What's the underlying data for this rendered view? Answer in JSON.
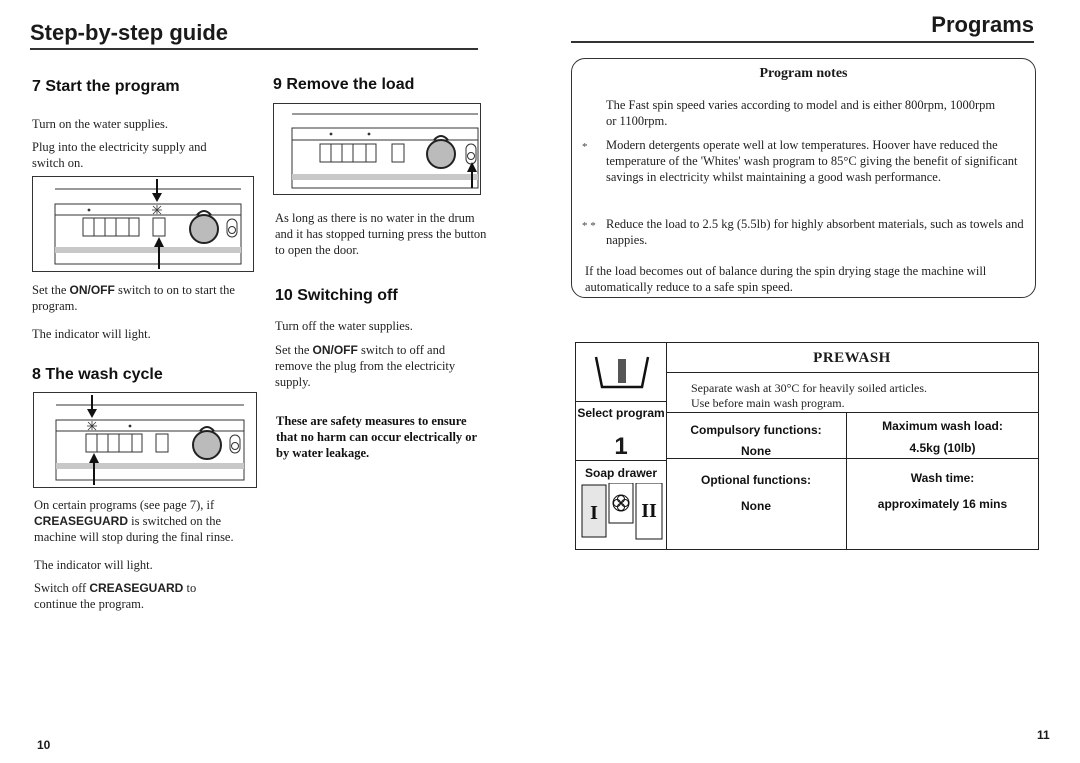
{
  "left_page": {
    "title": "Step-by-step  guide",
    "page_number": "10",
    "sections": {
      "start_program": {
        "heading": "7  Start the program",
        "para1": "Turn on the water supplies.",
        "para2": "Plug into the electricity supply and switch on.",
        "para3_prefix": "Set the ",
        "para3_bold": "ON/OFF",
        "para3_suffix": " switch to on to start the program.",
        "para4": "The indicator will light."
      },
      "wash_cycle": {
        "heading": "8  The wash cycle",
        "para1_prefix": "On certain programs (see page 7), if ",
        "para1_bold": "CREASEGUARD",
        "para1_suffix": " is switched on the machine will stop during the final rinse.",
        "para2": "The indicator will light.",
        "para3_prefix": "Switch off ",
        "para3_bold": "CREASEGUARD",
        "para3_suffix": " to continue the program."
      },
      "remove_load": {
        "heading": "9  Remove the load",
        "para1": "As long as there is no water in the drum and it has stopped turning press the button to open the door."
      },
      "switching_off": {
        "heading": "10  Switching off",
        "para1": "Turn off the water supplies.",
        "para2_prefix": "Set the ",
        "para2_bold": "ON/OFF",
        "para2_suffix": " switch to off and remove the plug from the electricity supply.",
        "para3": "These are safety measures to ensure that no harm can occur electrically or by water leakage."
      }
    }
  },
  "right_page": {
    "title": "Programs",
    "page_number": "11",
    "program_notes": {
      "title": "Program notes",
      "note1": "The Fast spin speed varies according to model and is either 800rpm, 1000rpm or 1100rpm.",
      "note2_marker": "*",
      "note2": "Modern detergents operate well at low temperatures. Hoover have reduced the temperature of the 'Whites' wash program to 85°C giving the benefit of significant savings in electricity whilst maintaining a good wash performance.",
      "note3_marker": "* *",
      "note3": "Reduce the load to 2.5 kg (5.5lb) for highly absorbent materials, such as towels and nappies.",
      "note4": "If the load becomes out of balance during the spin drying stage the machine will automatically reduce to a safe spin speed."
    },
    "program_table": {
      "title": "PREWASH",
      "description_line1": "Separate wash at 30°C for heavily soiled articles.",
      "description_line2": "Use before main wash program.",
      "select_program_label": "Select program",
      "select_program_value": "1",
      "soap_drawer_label": "Soap drawer",
      "soap_drawer_compartments": [
        "I",
        "flower-symbol",
        "II"
      ],
      "compulsory_label": "Compulsory functions:",
      "compulsory_value": "None",
      "max_load_label": "Maximum wash load:",
      "max_load_value": "4.5kg (10lb)",
      "optional_label": "Optional functions:",
      "optional_value": "None",
      "wash_time_label": "Wash time:",
      "wash_time_value": "approximately 16 mins"
    }
  }
}
